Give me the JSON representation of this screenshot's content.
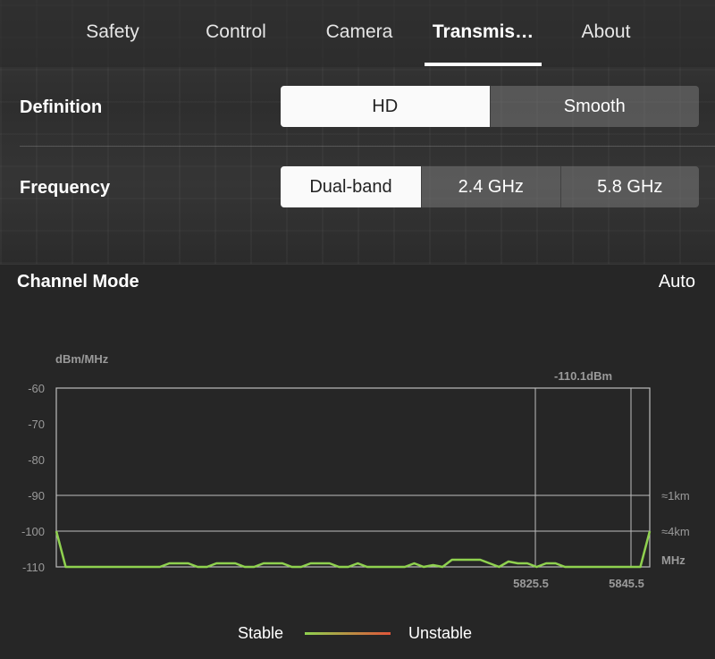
{
  "tabs": [
    {
      "label": "Safety",
      "active": false
    },
    {
      "label": "Control",
      "active": false
    },
    {
      "label": "Camera",
      "active": false
    },
    {
      "label": "Transmis…",
      "active": true
    },
    {
      "label": "About",
      "active": false
    }
  ],
  "definition": {
    "label": "Definition",
    "options": [
      "HD",
      "Smooth"
    ],
    "selected": "HD"
  },
  "frequency": {
    "label": "Frequency",
    "options": [
      "Dual-band",
      "2.4 GHz",
      "5.8 GHz"
    ],
    "selected": "Dual-band"
  },
  "channel_mode": {
    "label": "Channel Mode",
    "value": "Auto"
  },
  "legend": {
    "stable": "Stable",
    "unstable": "Unstable",
    "colors": {
      "stable": "#8fd14f",
      "unstable": "#e0553a"
    }
  },
  "chart_data": {
    "type": "line",
    "ylabel": "dBm/MHz",
    "xlabel": "MHz",
    "ylim": [
      -110,
      -60
    ],
    "y_ticks": [
      -60,
      -70,
      -80,
      -90,
      -100,
      -110
    ],
    "x_tick_labels": [
      "5825.5",
      "5845.5"
    ],
    "cursor_label": "-110.1dBm",
    "distance_markers": [
      {
        "label": "≈1km",
        "value": -90
      },
      {
        "label": "≈4km",
        "value": -100
      }
    ],
    "series": [
      {
        "color": "#8fd14f",
        "values": [
          -100,
          -110,
          -110,
          -110,
          -110,
          -110,
          -110,
          -110,
          -110,
          -110,
          -110,
          -110,
          -109,
          -109,
          -109,
          -110,
          -110,
          -109,
          -109,
          -109,
          -110,
          -110,
          -109,
          -109,
          -109,
          -110,
          -110,
          -109,
          -109,
          -109,
          -110,
          -110,
          -109,
          -110,
          -110,
          -110,
          -110,
          -110,
          -109,
          -110,
          -109.5,
          -110,
          -108,
          -108,
          -108,
          -108,
          -109,
          -110,
          -108.5,
          -109,
          -109,
          -110,
          -109,
          -109,
          -110,
          -110,
          -110,
          -110,
          -110,
          -110,
          -110,
          -110,
          -110,
          -100
        ]
      }
    ]
  }
}
